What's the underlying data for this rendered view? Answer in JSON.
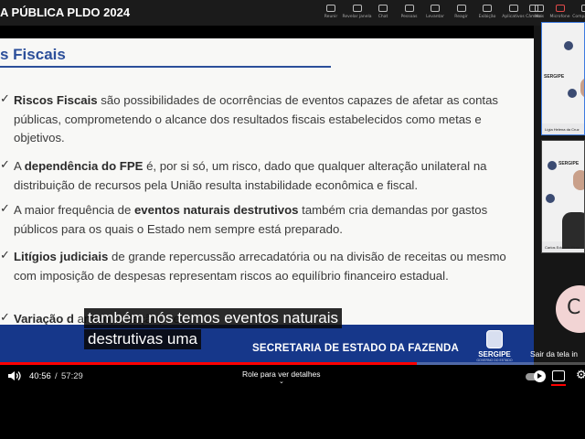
{
  "meeting": {
    "title": "A PÚBLICA PLDO 2024",
    "toolbar": [
      {
        "label": "Reunir",
        "icon": "meeting-icon"
      },
      {
        "label": "Revelar janela",
        "icon": "window-icon"
      },
      {
        "label": "Chat",
        "icon": "chat-icon"
      },
      {
        "label": "Pessoas",
        "icon": "people-icon"
      },
      {
        "label": "Levantar",
        "icon": "raise-hand-icon"
      },
      {
        "label": "Reagir",
        "icon": "react-icon"
      },
      {
        "label": "Exibição",
        "icon": "view-icon"
      },
      {
        "label": "Aplicativos",
        "icon": "apps-icon"
      },
      {
        "label": "Mais",
        "icon": "more-icon"
      }
    ],
    "toolbar2": [
      {
        "label": "Câmera",
        "icon": "camera-icon"
      },
      {
        "label": "Microfone",
        "icon": "microphone-icon"
      },
      {
        "label": "Compartilhar",
        "icon": "share-icon"
      }
    ]
  },
  "slide": {
    "title": "s Fiscais",
    "bullets": [
      {
        "bold": "Riscos Fiscais",
        "rest": " são possibilidades de ocorrências de eventos capazes de afetar as contas públicas, comprometendo o alcance dos resultados fiscais estabelecidos como metas e objetivos."
      },
      {
        "pre": "A ",
        "bold": "dependência do FPE",
        "rest": " é, por si só, um risco, dado que qualquer alteração unilateral na distribuição de recursos pela União resulta instabilidade econômica e fiscal."
      },
      {
        "pre": "A maior frequência de ",
        "bold": "eventos naturais destrutivos",
        "rest": " também cria demandas por gastos públicos para os quais o Estado nem sempre está preparado."
      },
      {
        "bold": "Litígios judiciais",
        "rest": " de grande repercussão arrecadatória ou na divisão de receitas ou mesmo com imposição de despesas representam riscos ao equilíbrio financeiro estadual."
      },
      {
        "bold": "Variação d",
        "rest": "                                                                    ambio, inflação, Selic."
      }
    ],
    "footer": "SECRETARIA DE ESTADO  DA FAZENDA",
    "logo_text": "SERGIPE",
    "logo_sub": "GOVERNO DO ESTADO"
  },
  "participants": [
    {
      "name": "Lígia Helena da Cruz",
      "wall_text": "SERGIPE"
    },
    {
      "name": "Carlos Eduardo Pinto",
      "wall_text": "SERGIPE"
    }
  ],
  "avatar_letter": "C",
  "exit_fullscreen": "Sair da tela in",
  "captions": [
    "também nós temos eventos naturais",
    "destrutivas uma"
  ],
  "player": {
    "current_time": "40:56",
    "separator": "/",
    "total_time": "57:29",
    "progress_fraction": 0.712,
    "scroll_hint": "Role para ver detalhes",
    "scroll_chevron": "⌄",
    "settings_glyph": "⚙",
    "accent": "#ff0000"
  }
}
